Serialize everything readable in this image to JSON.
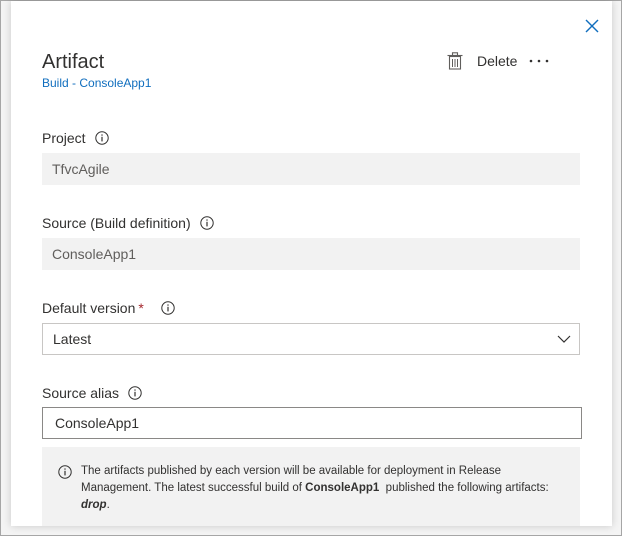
{
  "panel": {
    "title": "Artifact",
    "subtitle": "Build - ConsoleApp1",
    "delete_label": "Delete"
  },
  "project": {
    "label": "Project",
    "value": "TfvcAgile"
  },
  "source": {
    "label": "Source (Build definition)",
    "value": "ConsoleApp1"
  },
  "default_version": {
    "label": "Default version",
    "required_mark": "*",
    "selected": "Latest"
  },
  "source_alias": {
    "label": "Source alias",
    "value": "ConsoleApp1"
  },
  "notice": {
    "text_1": "The artifacts published by each version will be available for deployment in Release Management. The latest successful build of ",
    "build_name": "ConsoleApp1",
    "text_2": "  published the following artifacts: ",
    "artifact": "drop",
    "text_3": "."
  },
  "icons": {
    "close": "close-icon",
    "delete": "trash-icon",
    "more": "more-icon",
    "info": "info-icon",
    "dropdown": "chevron-down-icon"
  },
  "colors": {
    "link": "#106ebe",
    "close": "#106ebe",
    "required": "#a4262c",
    "readonly_bg": "#f2f2f2"
  }
}
